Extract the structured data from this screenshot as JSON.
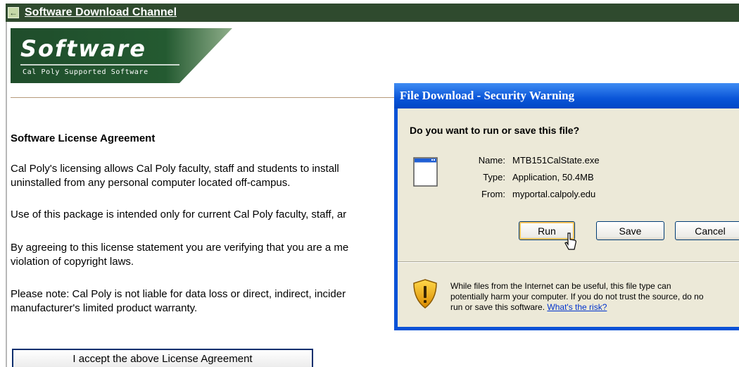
{
  "channel": {
    "title": "Software Download Channel",
    "back_icon": "back-arrow-icon"
  },
  "banner": {
    "title": "Software",
    "subtitle": "Cal Poly Supported Software"
  },
  "license": {
    "heading": "Software License Agreement",
    "p1_line1": "Cal Poly's licensing allows Cal Poly faculty, staff and students to install",
    "p1_line2": "uninstalled from any personal computer located off-campus.",
    "p2": "Use of this package is intended only for current Cal Poly faculty, staff, ar",
    "p3_line1": "By agreeing to this license statement you are verifying that you are a me",
    "p3_line2": "violation of copyright laws.",
    "p4_line1": "Please note: Cal Poly is not liable for data loss or direct, indirect, incider",
    "p4_line2": "manufacturer's limited product warranty.",
    "accept_label": "I accept the above License Agreement"
  },
  "dialog": {
    "title": "File Download - Security Warning",
    "question": "Do you want to run or save this file?",
    "name_label": "Name:",
    "name_value": "MTB151CalState.exe",
    "type_label": "Type:",
    "type_value": "Application, 50.4MB",
    "from_label": "From:",
    "from_value": "myportal.calpoly.edu",
    "run_label": "Run",
    "save_label": "Save",
    "cancel_label": "Cancel",
    "warning_line1": "While files from the Internet can be useful, this file type can",
    "warning_line2": "potentially harm your computer. If you do not trust the source, do no",
    "warning_line3": "run or save this software.",
    "risk_link": "What's the risk?",
    "icons": [
      "application-file-icon",
      "security-shield-icon",
      "pointer-cursor-icon"
    ]
  },
  "colors": {
    "channel_bar": "#2f4a2e",
    "banner_green": "#1f4d2b",
    "dialog_blue": "#0a52d6",
    "dialog_face": "#ece9d8",
    "link_blue": "#0033cc"
  }
}
